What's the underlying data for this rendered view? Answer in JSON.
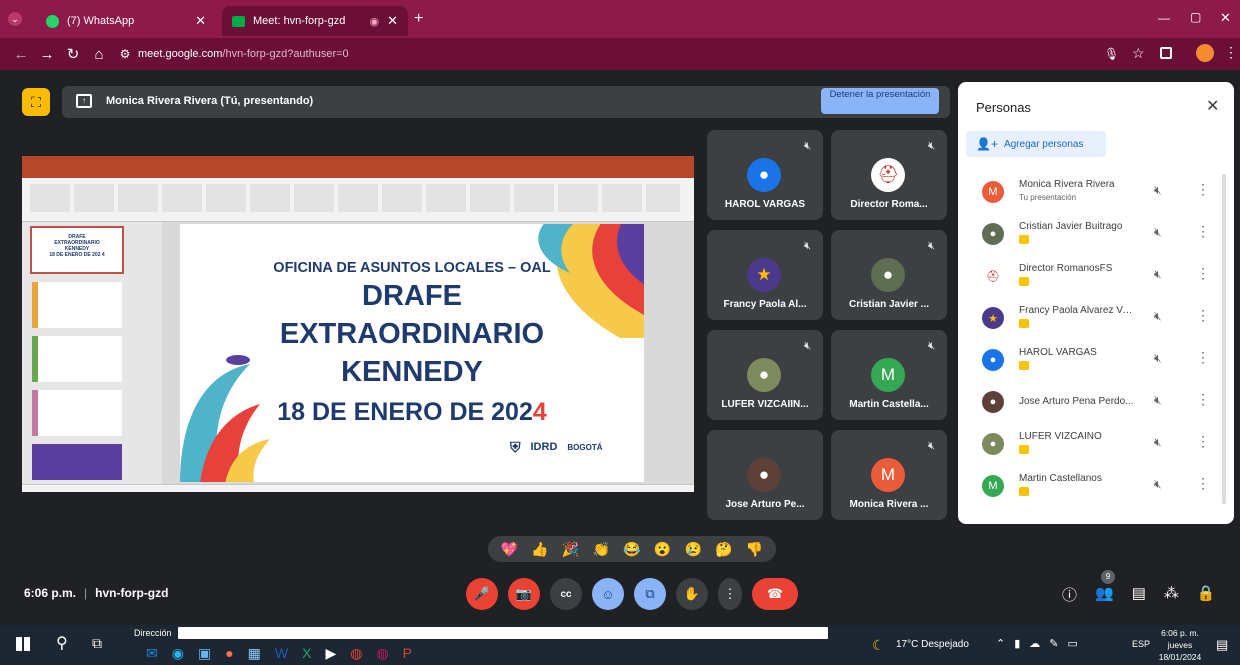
{
  "browser": {
    "tabs": [
      {
        "label": "(7) WhatsApp",
        "icon": "whatsapp-icon"
      },
      {
        "label": "Meet: hvn-forp-gzd",
        "icon": "meet-icon"
      }
    ],
    "url_host": "meet.google.com",
    "url_path": "/hvn-forp-gzd?authuser=0"
  },
  "presenter": {
    "label": "Monica Rivera Rivera (Tú, presentando)",
    "stop_button": "Detener la presentación"
  },
  "slide": {
    "line1": "OFICINA DE ASUNTOS LOCALES – OAL",
    "line2": "DRAFE",
    "line3": "EXTRAORDINARIO",
    "line4": "KENNEDY",
    "line5_main": "18 DE ENERO DE 202",
    "line5_last": "4",
    "logo1": "IDRD",
    "logo2": "BOGOTÁ",
    "thumb1_l1": "DRAFE",
    "thumb1_l2": "EXTRAORDINARIO",
    "thumb1_l3": "KENNEDY",
    "thumb1_l4": "18 DE ENERO DE 202 4"
  },
  "tiles": [
    {
      "name": "HAROL VARGAS"
    },
    {
      "name": "Director Roma..."
    },
    {
      "name": "Francy Paola Al..."
    },
    {
      "name": "Cristian Javier ..."
    },
    {
      "name": "LUFER VIZCAIIN..."
    },
    {
      "name": "Martin Castella...",
      "initial": "M"
    },
    {
      "name": "Jose Arturo Pe..."
    },
    {
      "name": "Monica Rivera ...",
      "initial": "M"
    }
  ],
  "panel": {
    "title": "Personas",
    "add_people": "Agregar personas",
    "people": [
      {
        "name": "Monica Rivera Rivera",
        "sub": "Tu presentación"
      },
      {
        "name": "Cristian Javier Buitrago"
      },
      {
        "name": "Director RomanosFS"
      },
      {
        "name": "Francy Paola Alvarez Ver..."
      },
      {
        "name": "HAROL VARGAS"
      },
      {
        "name": "Jose Arturo Pena Perdo..."
      },
      {
        "name": "LUFER VIZCAINO"
      },
      {
        "name": "Martin Castellanos"
      }
    ]
  },
  "reactions": [
    "💖",
    "👍",
    "🎉",
    "👏",
    "😂",
    "😮",
    "😢",
    "🤔",
    "👎"
  ],
  "footer": {
    "time": "6:06 p.m.",
    "separator": "|",
    "meeting_code": "hvn-forp-gzd",
    "people_count": "9"
  },
  "taskbar": {
    "address_label": "Dirección",
    "weather": "17°C Despejado",
    "lang": "ESP",
    "time": "6:06 p. m.",
    "day": "jueves",
    "date": "18/01/2024"
  },
  "colors": {
    "tab_bar": "#8e1a4a",
    "address_bar": "#6b0f37",
    "meet_bg": "#202124",
    "tile_bg": "#3c4043",
    "end_call": "#ea4335",
    "accent_blue": "#8ab4f8"
  }
}
